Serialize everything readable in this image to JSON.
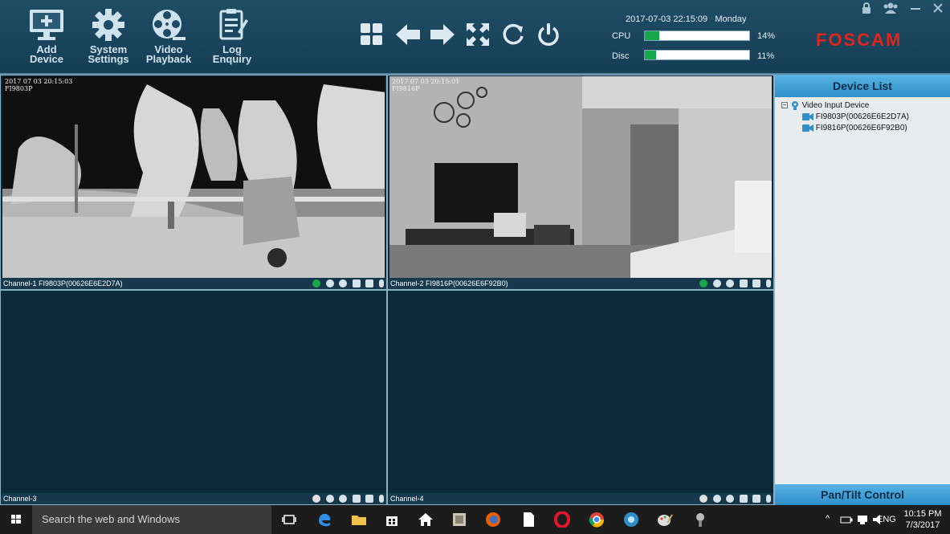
{
  "toolbar": {
    "buttons": [
      {
        "label": "Add\nDevice"
      },
      {
        "label": "System\nSettings"
      },
      {
        "label": "Video\nPlayback"
      },
      {
        "label": "Log\nEnquiry"
      }
    ],
    "datetime": "2017-07-03 22:15:09",
    "weekday": "Monday",
    "cpu_label": "CPU",
    "cpu_pct": "14%",
    "cpu_value": 14,
    "disc_label": "Disc",
    "disc_pct": "11%",
    "disc_value": 11,
    "brand": "FOSCAM",
    "brand_color": "#e2241b"
  },
  "channels": [
    {
      "label": "Channel-1  FI9803P(00626E6E2D7A)",
      "osd_time": "2017 07 03  20:15:03",
      "osd_name": "FI9803P",
      "status_color": "#16a84a"
    },
    {
      "label": "Channel-2  FI9816P(00626E6F92B0)",
      "osd_time": "2017 07 03  20:15:01",
      "osd_name": "FI9816P",
      "status_color": "#16a84a"
    },
    {
      "label": "Channel-3",
      "status_color": "#e0e0e0"
    },
    {
      "label": "Channel-4",
      "status_color": "#e0e0e0"
    }
  ],
  "sidebar": {
    "title": "Device List",
    "root": "Video Input Device",
    "devices": [
      "FI9803P(00626E6E2D7A)",
      "FI9816P(00626E6F92B0)"
    ],
    "footer": "Pan/Tilt Control"
  },
  "taskbar": {
    "search_placeholder": "Search the web and Windows",
    "lang": "ENG",
    "time": "10:15 PM",
    "date": "7/3/2017"
  }
}
